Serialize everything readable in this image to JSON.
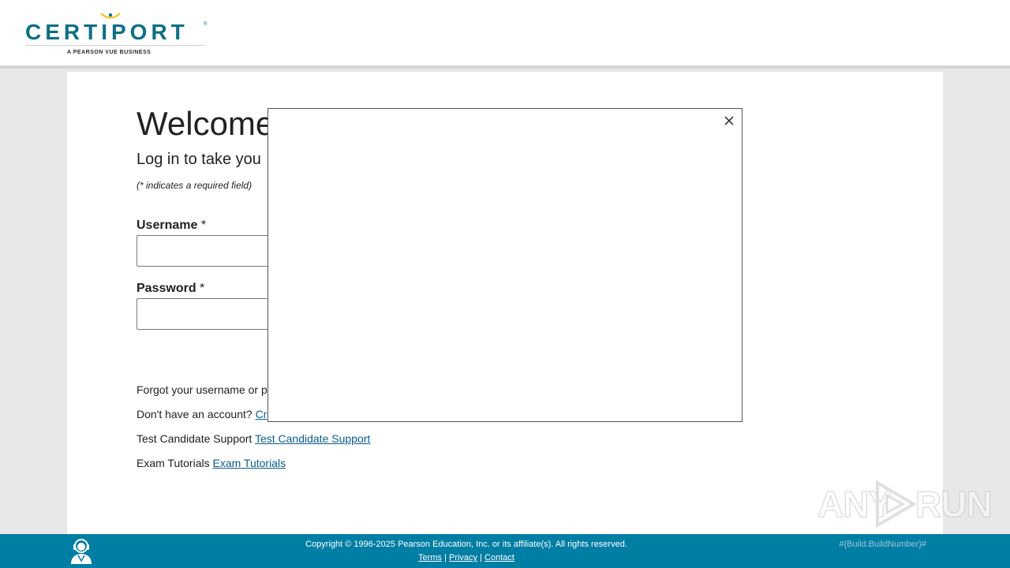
{
  "header": {
    "logo_word": "CERTIPORT",
    "logo_registered": "®",
    "logo_tagline": "A PEARSON VUE BUSINESS"
  },
  "login": {
    "title": "Welcome",
    "subtitle": "Log in to take you",
    "required_note": "(* indicates a required field)",
    "username_label": "Username",
    "password_label": "Password",
    "required_mark": "*",
    "username_value": "",
    "password_value": ""
  },
  "links": {
    "forgot_text": "Forgot your username or p",
    "no_account_text": "Don't have an account?",
    "create_link": "Cr",
    "support_text": "Test Candidate Support",
    "support_link": "Test Candidate Support",
    "tutorials_text": "Exam Tutorials",
    "tutorials_link": "Exam Tutorials"
  },
  "modal": {
    "close_icon": "close-icon"
  },
  "watermark": {
    "text_left": "ANY",
    "text_right": "RUN"
  },
  "footer": {
    "copyright": "Copyright © 1996-2025 Pearson Education, Inc. or its affiliate(s). All rights reserved.",
    "terms": "Terms",
    "privacy": "Privacy",
    "contact": "Contact",
    "separator": "|",
    "build": "#{Build.BuildNumber}#",
    "support_icon": "support-agent-icon"
  },
  "colors": {
    "brand_teal": "#0e6f86",
    "logo_accent": "#f2c417",
    "footer_bg": "#007ea4",
    "link": "#0a5c8f"
  }
}
